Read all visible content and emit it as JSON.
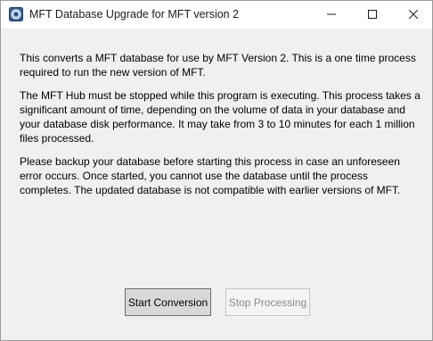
{
  "window": {
    "title": "MFT Database Upgrade for MFT version 2",
    "app_icon": "database-app-icon",
    "controls": [
      "minimize-icon",
      "maximize-icon",
      "close-icon"
    ]
  },
  "content": {
    "paragraphs": [
      "This converts a MFT database for use by MFT Version 2. This is a one time process required to run the new version of MFT.",
      "The MFT Hub must be stopped while this program is executing. This process takes a significant amount of time, depending on the volume of data in your database and your database disk performance. It may take from 3 to 10 minutes for each 1 million files processed.",
      "Please backup your database before starting this process in case an unforeseen error occurs. Once started, you cannot use the database until the process completes. The updated database is not compatible with earlier versions of MFT."
    ]
  },
  "buttons": {
    "start_label": "Start Conversion",
    "stop_label": "Stop Processing",
    "stop_enabled": false
  }
}
